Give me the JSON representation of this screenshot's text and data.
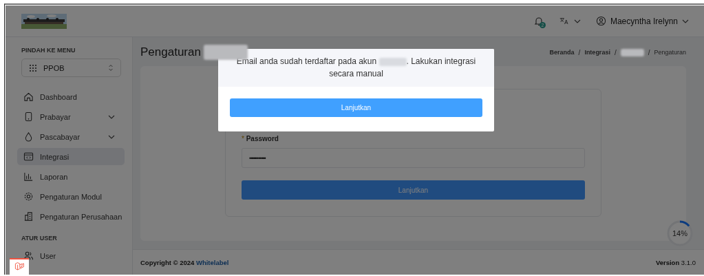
{
  "header": {
    "notification_badge": "2",
    "user_name": "Maecyntha Irelynn"
  },
  "sidebar": {
    "section_title": "PINDAH KE MENU",
    "module_select": {
      "value": "PPOB"
    },
    "items": [
      {
        "kind": "link",
        "label": "Dashboard",
        "selected": false
      },
      {
        "kind": "group",
        "label": "Prabayar",
        "selected": false,
        "expanded": false
      },
      {
        "kind": "group",
        "label": "Pascabayar",
        "selected": false,
        "expanded": false
      },
      {
        "kind": "link",
        "label": "Integrasi",
        "selected": true
      },
      {
        "kind": "link",
        "label": "Laporan",
        "selected": false
      },
      {
        "kind": "link",
        "label": "Pengaturan Modul",
        "selected": false
      },
      {
        "kind": "link",
        "label": "Pengaturan Perusahaan",
        "selected": false
      }
    ],
    "user_section_title": "ATUR USER",
    "user_items": [
      {
        "kind": "link",
        "label": "User",
        "selected": false
      }
    ]
  },
  "page": {
    "title": "Pengaturan",
    "breadcrumb": [
      {
        "kind": "link",
        "label": "Beranda"
      },
      {
        "kind": "separator",
        "label": "/"
      },
      {
        "kind": "link",
        "label": "Integrasi"
      },
      {
        "kind": "separator",
        "label": "/"
      },
      {
        "kind": "redacted"
      },
      {
        "kind": "separator",
        "label": "/"
      },
      {
        "kind": "current",
        "label": "Pengaturan"
      }
    ],
    "form": {
      "password_label": "Password",
      "required_mark": "*",
      "password_mask": "•••••••••••",
      "submit": "Lanjutkan"
    }
  },
  "footer": {
    "copyright": "Copyright © 2024",
    "brand": "Whitelabel",
    "version_label": "Version",
    "version": "3.1.0"
  },
  "progress": {
    "level": 0.14,
    "label": "14%"
  },
  "modal": {
    "message_before": "Email anda sudah terdaftar pada akun",
    "message_after": ". Lakukan integrasi secara manual",
    "button": "Lanjutkan"
  }
}
